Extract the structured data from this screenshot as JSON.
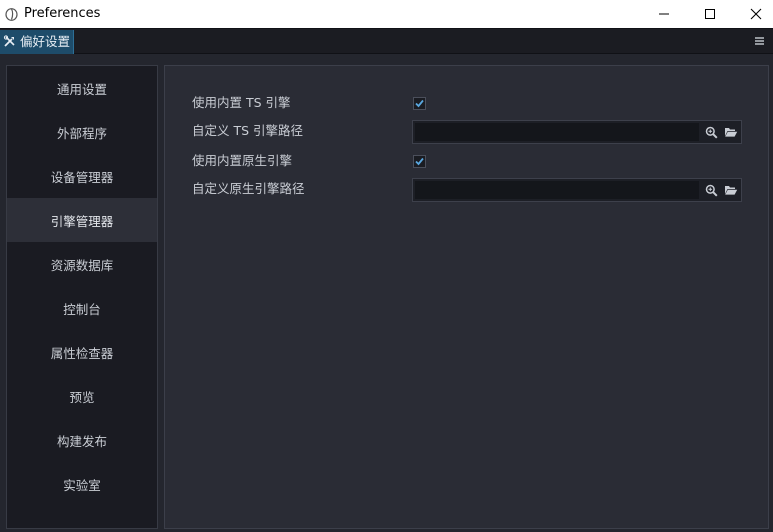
{
  "window": {
    "title": "Preferences",
    "icons": [
      "app-icon",
      "minimize-icon",
      "maximize-icon",
      "close-icon"
    ]
  },
  "tabs": {
    "active_tab": {
      "label": "偏好设置",
      "icon": "tools-icon"
    },
    "menu_icon": "hamburger-icon"
  },
  "sidebar": {
    "items": [
      {
        "label": "通用设置"
      },
      {
        "label": "外部程序"
      },
      {
        "label": "设备管理器"
      },
      {
        "label": "引擎管理器",
        "active": true
      },
      {
        "label": "资源数据库"
      },
      {
        "label": "控制台"
      },
      {
        "label": "属性检查器"
      },
      {
        "label": "预览"
      },
      {
        "label": "构建发布"
      },
      {
        "label": "实验室"
      }
    ]
  },
  "engine": {
    "use_builtin_ts": {
      "label": "使用内置 TS 引擎",
      "checked": true
    },
    "custom_ts_path": {
      "label": "自定义 TS 引擎路径",
      "value": "",
      "icons": [
        "search-icon",
        "folder-open-icon"
      ]
    },
    "use_builtin_native": {
      "label": "使用内置原生引擎",
      "checked": true
    },
    "custom_native_path": {
      "label": "自定义原生引擎路径",
      "value": "",
      "icons": [
        "search-icon",
        "folder-open-icon"
      ]
    }
  },
  "colors": {
    "accent": "#1e4c6a",
    "check": "#5aa8e0",
    "background": "#24262e",
    "panel": "#2a2c35",
    "sidebar": "#1a1b22"
  }
}
